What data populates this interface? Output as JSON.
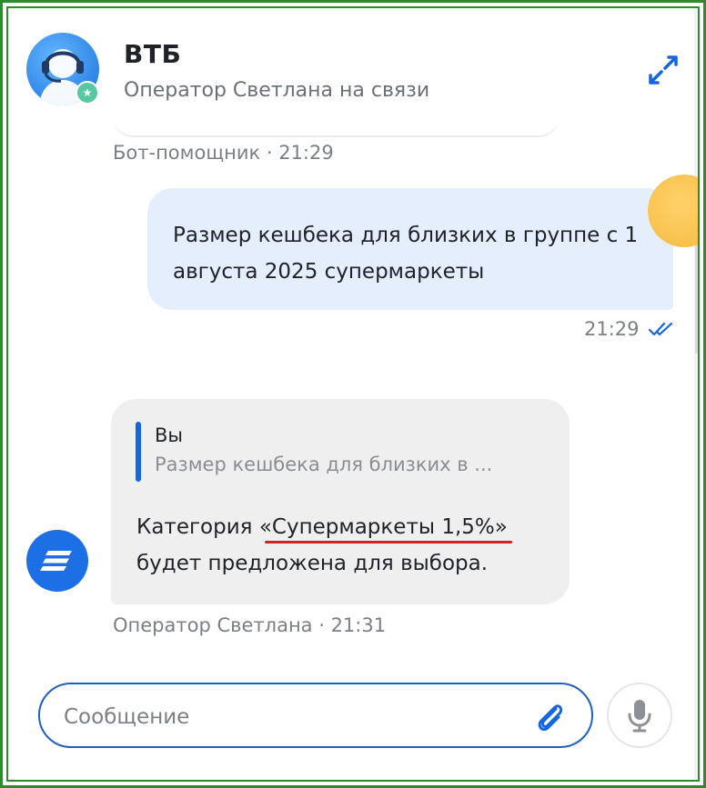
{
  "header": {
    "title": "ВТБ",
    "subtitle": "Оператор Светлана на связи",
    "avatar_icon": "support-operator-headset-icon",
    "online_badge_icon": "star-badge-icon",
    "expand_icon": "expand-arrows-icon"
  },
  "messages": [
    {
      "type": "bot_meta",
      "meta": "Бот-помощник · 21:29"
    },
    {
      "type": "outgoing",
      "text": "Размер кешбека для близких в группе с 1 августа 2025 супермаркеты",
      "time": "21:29",
      "status_icon": "double-check-icon"
    },
    {
      "type": "incoming",
      "quote_author": "Вы",
      "quote_text": "Размер кешбека для близких в ...",
      "text_highlighted": "«Супермаркеты 1,5%»",
      "text_part1": "Категория",
      "text_part2": "будет предложена для выбора.",
      "meta": "Оператор Светлана · 21:31",
      "avatar_icon": "vtb-logo-icon"
    }
  ],
  "composer": {
    "placeholder": "Сообщение",
    "value": "",
    "attach_icon": "paperclip-icon",
    "mic_icon": "microphone-icon"
  },
  "colors": {
    "frame": "#2f8a2f",
    "accent": "#1565e0",
    "outgoing_bubble": "#e4eefc",
    "incoming_bubble": "#efefef",
    "highlight_underline": "#d91e1e"
  }
}
